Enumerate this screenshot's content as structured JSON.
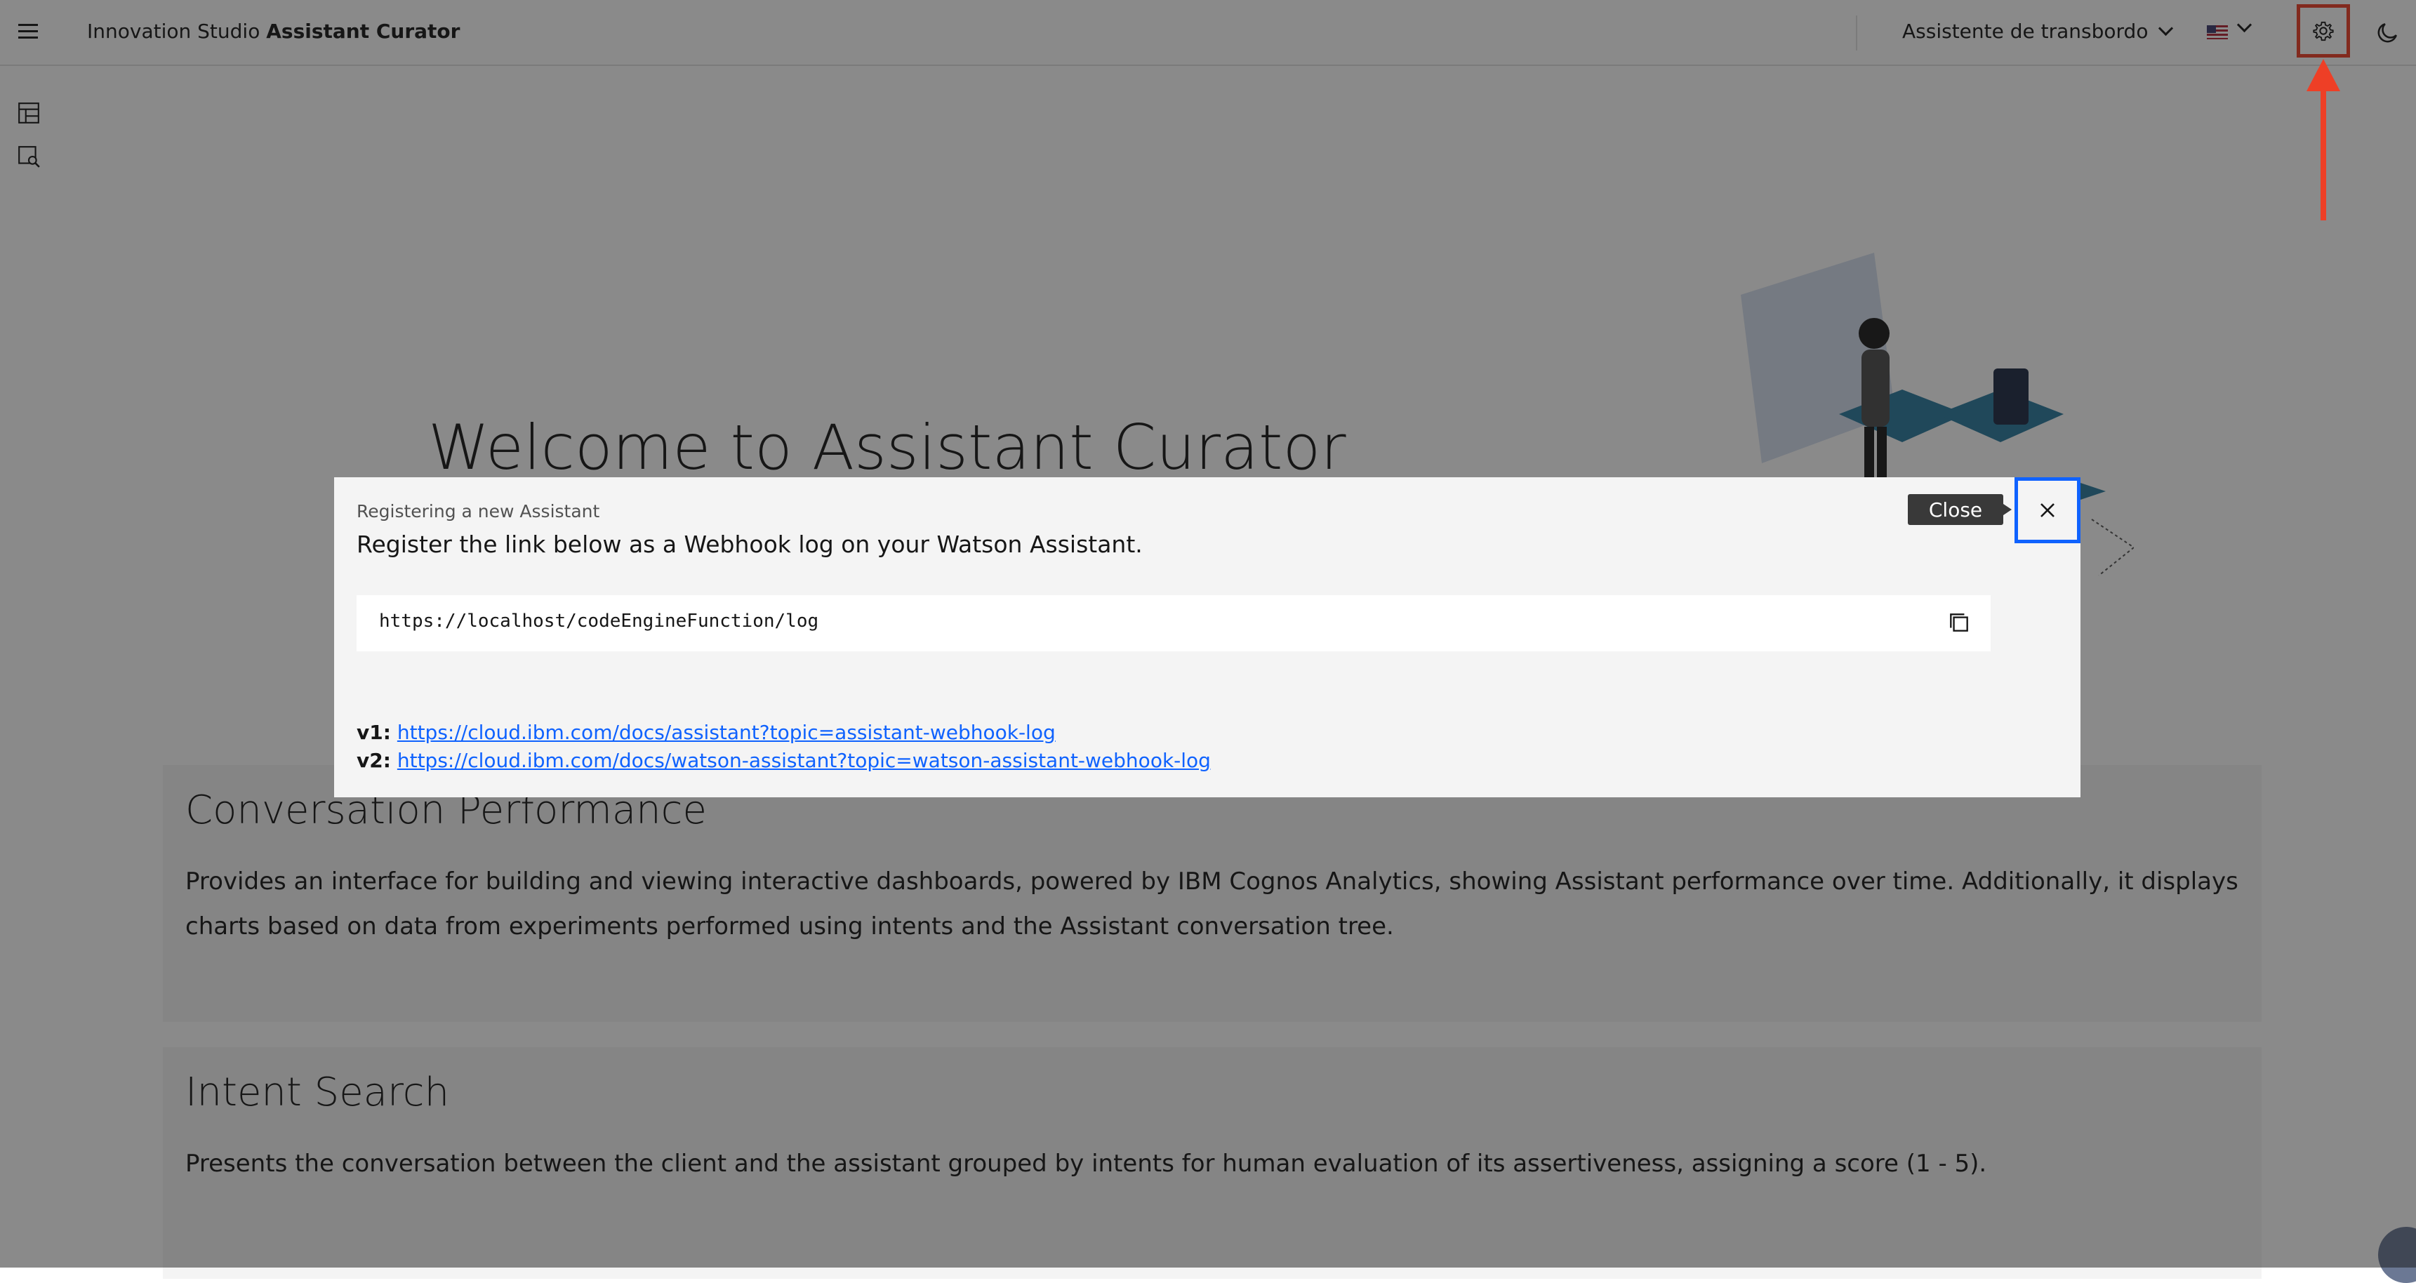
{
  "header": {
    "brand_light": "Innovation Studio",
    "brand_bold": "Assistant Curator",
    "assistant_select": "Assistente de transbordo",
    "language_flag": "us-flag-icon",
    "settings_icon": "gear-icon",
    "theme_icon": "moon-icon"
  },
  "rail": {
    "items": [
      "dashboard-icon",
      "search-document-icon"
    ]
  },
  "main": {
    "welcome_title": "Welcome to Assistant Curator",
    "cards": [
      {
        "title": "Conversation Performance",
        "description": "Provides an interface for building and viewing interactive dashboards, powered by IBM Cognos Analytics, showing Assistant performance over time. Additionally, it displays charts based on data from experiments performed using intents and the Assistant conversation tree."
      },
      {
        "title": "Intent Search",
        "description": "Presents the conversation between the client and the assistant grouped by intents for human evaluation of its assertiveness, assigning a score (1 - 5)."
      }
    ]
  },
  "modal": {
    "label": "Registering a new Assistant",
    "heading": "Register the link below as a Webhook log on your Watson Assistant.",
    "webhook_url": "https://localhost/codeEngineFunction/log",
    "links": [
      {
        "prefix": "v1:",
        "url": "https://cloud.ibm.com/docs/assistant?topic=assistant-webhook-log"
      },
      {
        "prefix": "v2:",
        "url": "https://cloud.ibm.com/docs/watson-assistant?topic=watson-assistant-webhook-log"
      }
    ],
    "close_tooltip": "Close"
  },
  "colors": {
    "annotation_red": "#ee3f26",
    "focus_blue": "#0f62fe",
    "link_blue": "#0f62fe",
    "overlay": "rgba(22,22,22,0.5)"
  }
}
